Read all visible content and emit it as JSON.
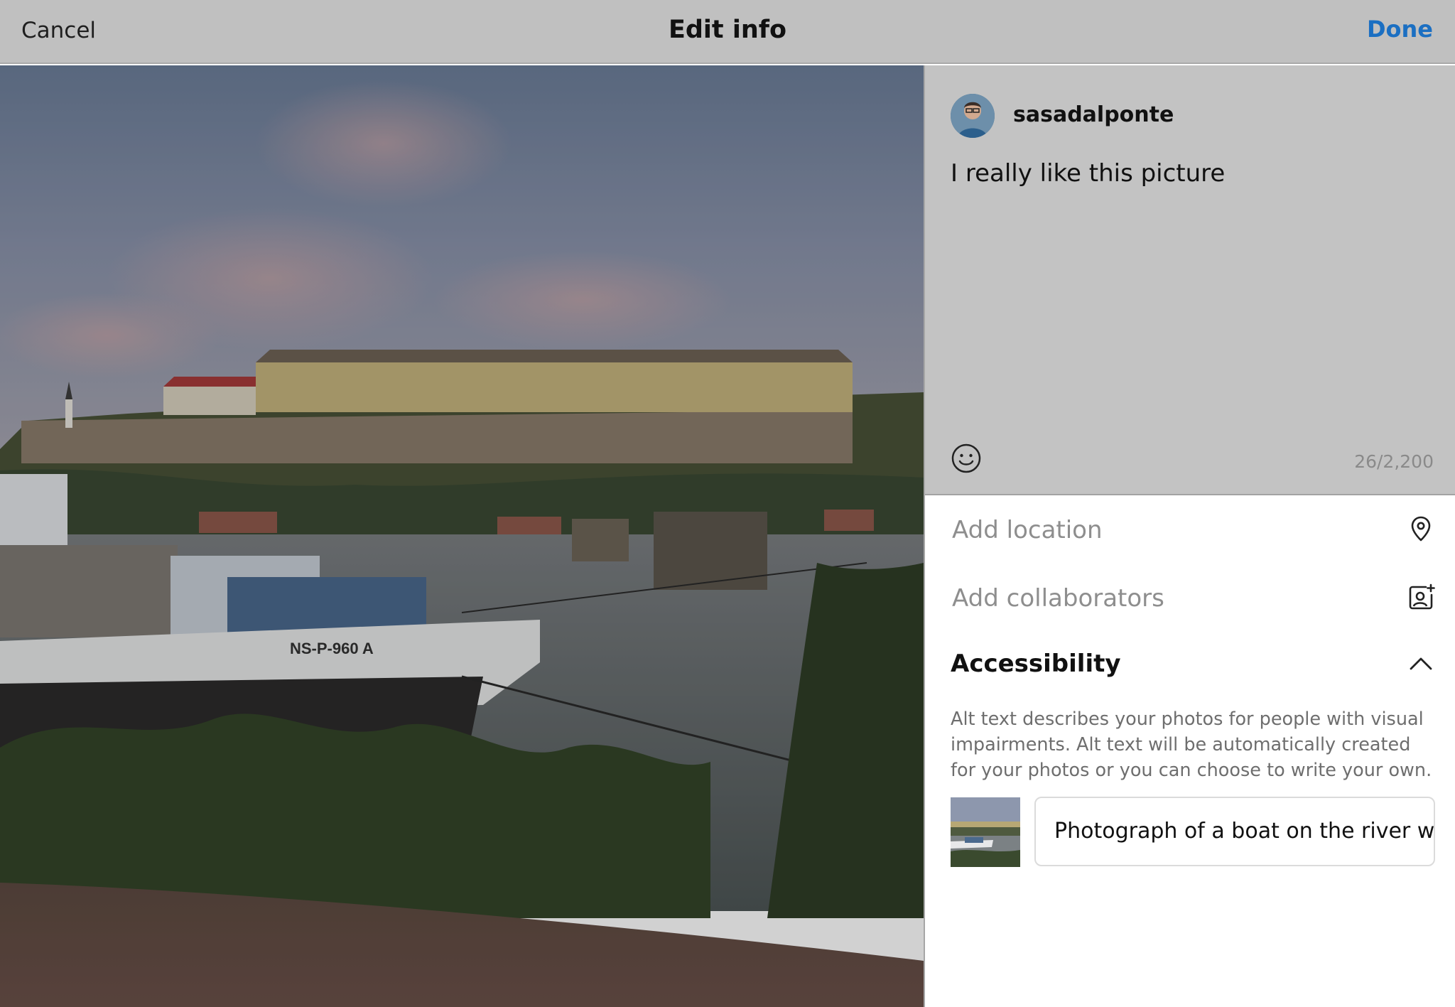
{
  "header": {
    "cancel_label": "Cancel",
    "title": "Edit info",
    "done_label": "Done"
  },
  "photo": {
    "boat_registration": "NS-P-960 A"
  },
  "post": {
    "username": "sasadalponte",
    "caption": "I really like this picture",
    "char_count": "26/2,200"
  },
  "options": {
    "add_location": "Add location",
    "add_collaborators": "Add collaborators"
  },
  "accessibility": {
    "title": "Accessibility",
    "description": "Alt text describes your photos for people with visual impairments. Alt text will be automatically created for your photos or you can choose to write your own.",
    "alt_text_value": "Photograph of a boat on the river wit"
  },
  "icons": {
    "emoji": "smiley-face-icon",
    "location": "location-pin-icon",
    "collaborators": "add-person-icon",
    "chevron": "chevron-up-icon"
  },
  "colors": {
    "accent": "#1b6fc2",
    "topbar_bg": "#c0c0c0",
    "caption_bg": "#c3c3c3"
  }
}
